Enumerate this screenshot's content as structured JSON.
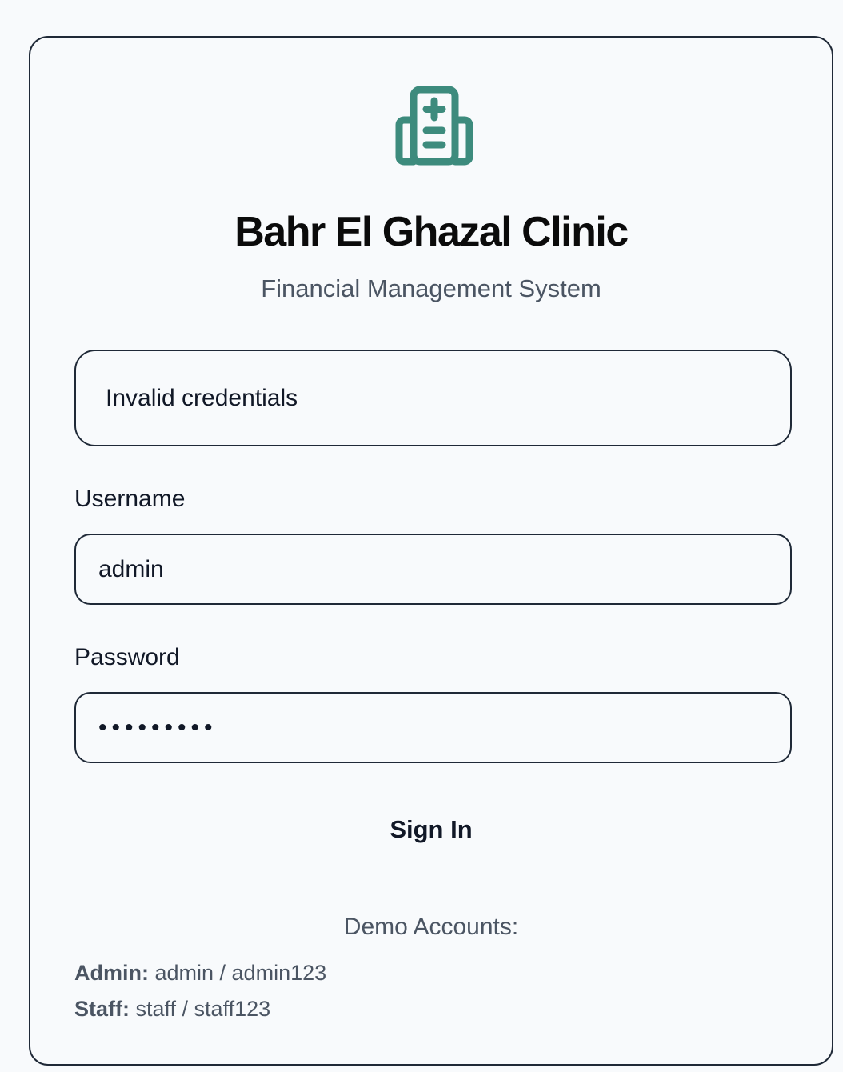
{
  "brand": {
    "logo_icon": "hospital-icon",
    "accent_color": "#3d8b7d",
    "title": "Bahr El Ghazal Clinic",
    "subtitle": "Financial Management System"
  },
  "alert": {
    "message": "Invalid credentials"
  },
  "form": {
    "username_label": "Username",
    "username_value": "admin",
    "password_label": "Password",
    "password_value": "admin123x",
    "submit_label": "Sign In"
  },
  "demo": {
    "title": "Demo Accounts:",
    "accounts": [
      {
        "role": "Admin:",
        "credentials": "admin / admin123"
      },
      {
        "role": "Staff:",
        "credentials": "staff / staff123"
      }
    ]
  }
}
